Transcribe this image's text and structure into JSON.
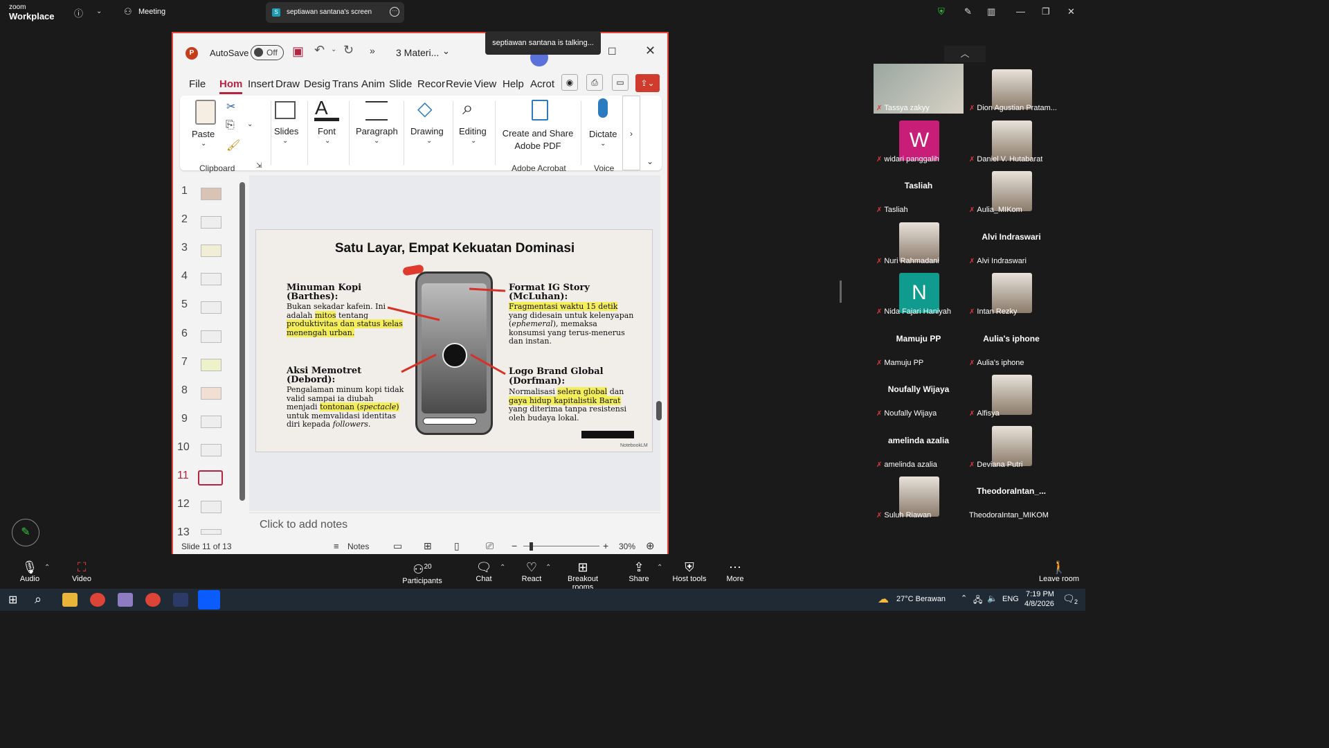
{
  "zoom": {
    "logo_top": "zoom",
    "logo_bottom": "Workplace",
    "meeting_tab": "Meeting",
    "share_tab": "septiawan santana's screen",
    "talking_toast": "septiawan santana is talking..."
  },
  "ppt": {
    "autosave_label": "AutoSave",
    "autosave_state": "Off",
    "filename": "3 Materi...",
    "menu": [
      "File",
      "Hom",
      "Insert",
      "Draw",
      "Desig",
      "Trans",
      "Anim",
      "Slide",
      "Recor",
      "Revie",
      "View",
      "Help",
      "Acrot"
    ],
    "ribbon": {
      "paste": "Paste",
      "clipboard": "Clipboard",
      "slides": "Slides",
      "font": "Font",
      "paragraph": "Paragraph",
      "drawing": "Drawing",
      "editing": "Editing",
      "create_pdf": "Create and Share Adobe PDF",
      "adobe_group": "Adobe Acrobat",
      "dictate": "Dictate",
      "voice_group": "Voice"
    },
    "thumb_numbers": [
      "1",
      "2",
      "3",
      "4",
      "5",
      "6",
      "7",
      "8",
      "9",
      "10",
      "11",
      "12",
      "13"
    ],
    "selected_slide": "11",
    "notes_placeholder": "Click to add notes",
    "status_slide": "Slide 11 of 13",
    "notes_btn": "Notes",
    "zoom_pct": "30%"
  },
  "slide": {
    "title": "Satu Layar, Empat Kekuatan Dominasi",
    "q1_head": "Minuman Kopi (Barthes):",
    "q1_a": "Bukan sekadar kafein. Ini adalah ",
    "q1_hl1": "mitos",
    "q1_b": " tentang ",
    "q1_hl2": "produktivitas dan status kelas menengah urban.",
    "q2_head": "Format IG Story (McLuhan):",
    "q2_hl": "Fragmentasi waktu 15 detik",
    "q2_a": " yang didesain untuk kelenyapan (",
    "q2_it": "ephemeral",
    "q2_b": "), memaksa konsumsi yang terus-menerus dan instan.",
    "q3_head": "Aksi Memotret (Debord):",
    "q3_a": "Pengalaman minum kopi tidak valid sampai ia diubah menjadi ",
    "q3_hl": "tontonan (",
    "q3_it": "spectacle",
    "q3_hl2": ")",
    "q3_b": " untuk memvalidasi identitas diri kepada ",
    "q3_it2": "followers",
    "q3_c": ".",
    "q4_head": "Logo Brand Global (Dorfman):",
    "q4_a": "Normalisasi ",
    "q4_hl1": "selera global",
    "q4_b": " dan ",
    "q4_hl2": "gaya hidup kapitalistik Barat",
    "q4_c": " yang diterima tanpa resistensi oleh budaya lokal.",
    "watermark": "NotebookLM"
  },
  "participants": [
    {
      "name": "Tassya zakyy",
      "type": "video"
    },
    {
      "name": "Dion Agustian Pratam...",
      "type": "photo"
    },
    {
      "name": "widari panggalih",
      "type": "letter",
      "letter": "W",
      "color": "#c81e78"
    },
    {
      "name": "Daniel V. Hutabarat",
      "type": "photo"
    },
    {
      "name": "Tasliah",
      "type": "name",
      "big": "Tasliah"
    },
    {
      "name": "Aulia_MIKom",
      "type": "photo"
    },
    {
      "name": "Nuri Rahmadani",
      "type": "photo"
    },
    {
      "name": "Alvi Indraswari",
      "type": "name",
      "big": "Alvi Indraswari"
    },
    {
      "name": "Nida Fajari Haniyah",
      "type": "letter",
      "letter": "N",
      "color": "#0f9b8e"
    },
    {
      "name": "Intan Rezky",
      "type": "photo"
    },
    {
      "name": "Mamuju PP",
      "type": "name",
      "big": "Mamuju PP"
    },
    {
      "name": "Aulia's iphone",
      "type": "name",
      "big": "Aulia's iphone"
    },
    {
      "name": "Noufally Wijaya",
      "type": "name",
      "big": "Noufally Wijaya"
    },
    {
      "name": "Alfisya",
      "type": "photo"
    },
    {
      "name": "amelinda azalia",
      "type": "name",
      "big": "amelinda azalia"
    },
    {
      "name": "Deviana Putri",
      "type": "photo"
    },
    {
      "name": "Suluh Riawan",
      "type": "photo"
    },
    {
      "name": "TheodoraIntan_MIKOM",
      "type": "name",
      "big": "TheodoraIntan_..."
    }
  ],
  "toolbar": {
    "audio": "Audio",
    "video": "Video",
    "participants": "Participants",
    "participants_count": "20",
    "chat": "Chat",
    "react": "React",
    "breakout": "Breakout rooms",
    "share": "Share",
    "host_tools": "Host tools",
    "more": "More",
    "leave": "Leave room"
  },
  "taskbar": {
    "weather": "27°C  Berawan",
    "lang": "ENG",
    "time": "7:19 PM",
    "date": "4/8/2026",
    "notif": "2"
  },
  "colors": {
    "accent_red": "#e5453a",
    "ppt_red": "#c43e1c",
    "highlight": "#f4ee5b"
  }
}
